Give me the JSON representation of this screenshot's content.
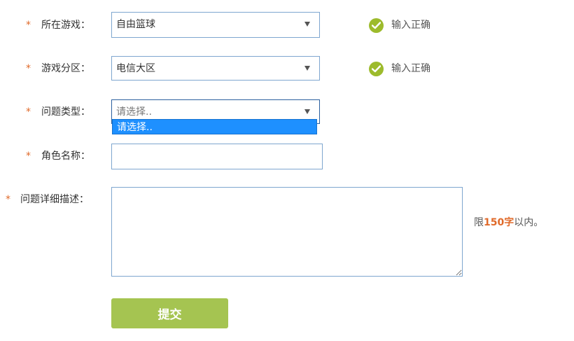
{
  "form": {
    "game": {
      "required_mark": "*",
      "label": "所在游戏：",
      "value": "自由篮球",
      "status": "输入正确"
    },
    "zone": {
      "required_mark": "*",
      "label": "游戏分区：",
      "value": "电信大区",
      "status": "输入正确"
    },
    "issue_type": {
      "required_mark": "*",
      "label": "问题类型：",
      "value": "请选择..",
      "dropdown_option": "请选择.."
    },
    "role_name": {
      "required_mark": "*",
      "label": "角色名称：",
      "value": ""
    },
    "description": {
      "required_mark": "*",
      "label": "问题详细描述：",
      "value": "",
      "limit_prefix": "限",
      "limit_count": "150字",
      "limit_suffix": "以内。"
    },
    "submit_label": "提交"
  },
  "colors": {
    "required": "#e06a2a",
    "field_border": "#7ea6cf",
    "check_ok": "#9dbb2c",
    "dropdown_highlight": "#1e90ff",
    "submit_bg": "#a5c451"
  },
  "icons": {
    "status_ok": "check-circle-icon",
    "select_arrow": "triangle-down-icon"
  }
}
